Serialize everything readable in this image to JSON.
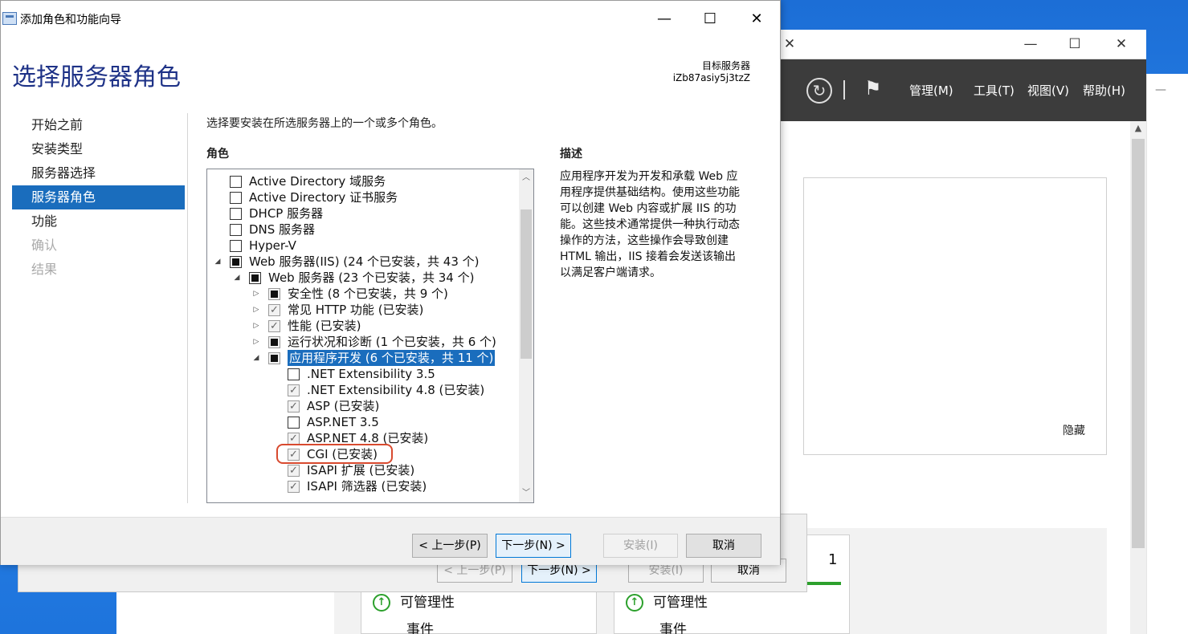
{
  "dialog": {
    "title": "添加角色和功能向导",
    "heading": "选择服务器角色",
    "target_label": "目标服务器",
    "target_name": "iZb87asiy5j3tzZ",
    "nav": [
      {
        "label": "开始之前",
        "state": "normal"
      },
      {
        "label": "安装类型",
        "state": "normal"
      },
      {
        "label": "服务器选择",
        "state": "normal"
      },
      {
        "label": "服务器角色",
        "state": "active"
      },
      {
        "label": "功能",
        "state": "normal"
      },
      {
        "label": "确认",
        "state": "disabled"
      },
      {
        "label": "结果",
        "state": "disabled"
      }
    ],
    "instruction": "选择要安装在所选服务器上的一个或多个角色。",
    "roles_label": "角色",
    "description_label": "描述",
    "description_lines": [
      "应用程序开发为开发和承载 Web 应",
      "用程序提供基础结构。使用这些功能",
      "可以创建 Web 内容或扩展 IIS 的功",
      "能。这些技术通常提供一种执行动态",
      "操作的方法，这些操作会导致创建",
      "HTML 输出，IIS 接着会发送该输出",
      "以满足客户端请求。"
    ],
    "roles": [
      {
        "label": "Active Directory 域服务",
        "level": 0,
        "expander": "",
        "check": "none"
      },
      {
        "label": "Active Directory 证书服务",
        "level": 0,
        "expander": "",
        "check": "none"
      },
      {
        "label": "DHCP 服务器",
        "level": 0,
        "expander": "",
        "check": "none"
      },
      {
        "label": "DNS 服务器",
        "level": 0,
        "expander": "",
        "check": "none"
      },
      {
        "label": "Hyper-V",
        "level": 0,
        "expander": "",
        "check": "none"
      },
      {
        "label": "Web 服务器(IIS) (24 个已安装，共 43 个)",
        "level": 0,
        "expander": "◢",
        "check": "partial"
      },
      {
        "label": "Web 服务器 (23 个已安装，共 34 个)",
        "level": 1,
        "expander": "◢",
        "check": "partial"
      },
      {
        "label": "安全性 (8 个已安装，共 9 个)",
        "level": 2,
        "expander": "▷",
        "check": "partial"
      },
      {
        "label": "常见 HTTP 功能 (已安装)",
        "level": 2,
        "expander": "▷",
        "check": "checked"
      },
      {
        "label": "性能 (已安装)",
        "level": 2,
        "expander": "▷",
        "check": "checked"
      },
      {
        "label": "运行状况和诊断 (1 个已安装，共 6 个)",
        "level": 2,
        "expander": "▷",
        "check": "partial"
      },
      {
        "label": "应用程序开发 (6 个已安装，共 11 个)",
        "level": 2,
        "expander": "◢",
        "check": "partial",
        "selected": true
      },
      {
        "label": ".NET Extensibility 3.5",
        "level": 3,
        "expander": "",
        "check": "none"
      },
      {
        "label": ".NET Extensibility 4.8 (已安装)",
        "level": 3,
        "expander": "",
        "check": "checked"
      },
      {
        "label": "ASP (已安装)",
        "level": 3,
        "expander": "",
        "check": "checked"
      },
      {
        "label": "ASP.NET 3.5",
        "level": 3,
        "expander": "",
        "check": "none"
      },
      {
        "label": "ASP.NET 4.8 (已安装)",
        "level": 3,
        "expander": "",
        "check": "checked"
      },
      {
        "label": "CGI (已安装)",
        "level": 3,
        "expander": "",
        "check": "checked"
      },
      {
        "label": "ISAPI 扩展 (已安装)",
        "level": 3,
        "expander": "",
        "check": "checked"
      },
      {
        "label": "ISAPI 筛选器 (已安装)",
        "level": 3,
        "expander": "",
        "check": "checked"
      }
    ],
    "buttons": {
      "prev": "< 上一步(P)",
      "next": "下一步(N) >",
      "install": "安装(I)",
      "cancel": "取消"
    }
  },
  "server_manager": {
    "menu": [
      "管理(M)",
      "工具(T)",
      "视图(V)",
      "帮助(H)"
    ],
    "hide_label": "隐藏",
    "tiles": [
      {
        "row1": "可管理性",
        "row2": "事件"
      },
      {
        "count": "1",
        "row1": "可管理性",
        "row2": "事件"
      }
    ]
  },
  "ghost_dialog": {
    "prev": "< 上一步(P)",
    "next": "下一步(N) >",
    "install": "安装(I)",
    "cancel": "取消"
  }
}
